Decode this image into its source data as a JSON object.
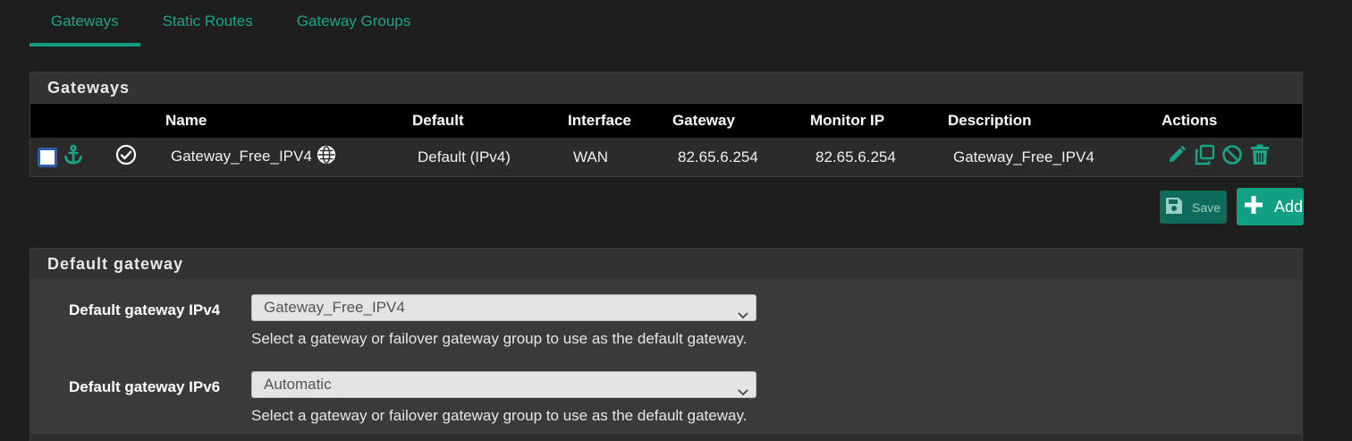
{
  "tabs": [
    "Gateways",
    "Static Routes",
    "Gateway Groups"
  ],
  "gateways_panel": {
    "title": "Gateways",
    "columns": {
      "name": "Name",
      "default": "Default",
      "interface": "Interface",
      "gateway": "Gateway",
      "monitor_ip": "Monitor IP",
      "description": "Description",
      "actions": "Actions"
    },
    "rows": [
      {
        "name": "Gateway_Free_IPV4",
        "default": "Default (IPv4)",
        "interface": "WAN",
        "gateway": "82.65.6.254",
        "monitor_ip": "82.65.6.254",
        "description": "Gateway_Free_IPV4"
      }
    ]
  },
  "buttons": {
    "save": "Save",
    "add": "Add"
  },
  "default_gateway_panel": {
    "title": "Default gateway",
    "ipv4": {
      "label": "Default gateway IPv4",
      "selected": "Gateway_Free_IPV4",
      "help": "Select a gateway or failover gateway group to use as the default gateway."
    },
    "ipv6": {
      "label": "Default gateway IPv6",
      "selected": "Automatic",
      "help": "Select a gateway or failover gateway group to use as the default gateway."
    }
  },
  "colors": {
    "accent": "#119e83",
    "background": "#1e1e1e",
    "panel": "#2d2d2d"
  },
  "icons": [
    "anchor-icon",
    "check-circle-icon",
    "globe-icon",
    "pencil-icon",
    "copy-icon",
    "disable-icon",
    "trash-icon",
    "save-icon",
    "plus-icon",
    "chevron-down-icon"
  ]
}
